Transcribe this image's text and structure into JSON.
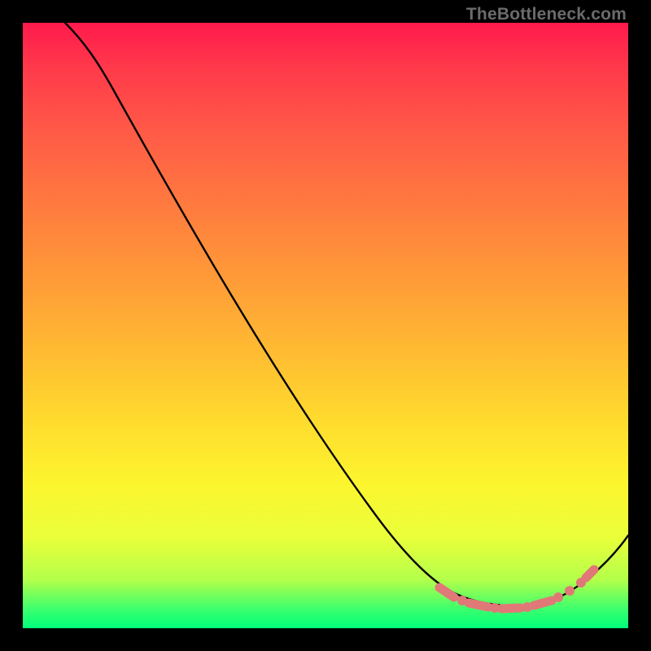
{
  "watermark": "TheBottleneck.com",
  "chart_data": {
    "type": "line",
    "title": "",
    "xlabel": "",
    "ylabel": "",
    "xlim": [
      0,
      100
    ],
    "ylim": [
      0,
      100
    ],
    "grid": false,
    "legend": false,
    "series": [
      {
        "name": "curve",
        "x": [
          7,
          10,
          15,
          20,
          25,
          30,
          35,
          40,
          45,
          50,
          55,
          60,
          65,
          70,
          73,
          76,
          79,
          82,
          85,
          88,
          91,
          94,
          97,
          100
        ],
        "values": [
          100,
          97,
          92,
          86,
          79,
          71,
          63,
          55,
          47,
          39,
          31,
          24,
          17,
          11,
          7,
          4,
          2.5,
          2,
          2,
          2.5,
          4,
          7,
          11,
          15
        ]
      }
    ],
    "annotations": [
      {
        "name": "optimal-band-markers",
        "x_start": 70,
        "x_end": 93,
        "note": "salmon markers/segments near curve minimum"
      }
    ]
  }
}
